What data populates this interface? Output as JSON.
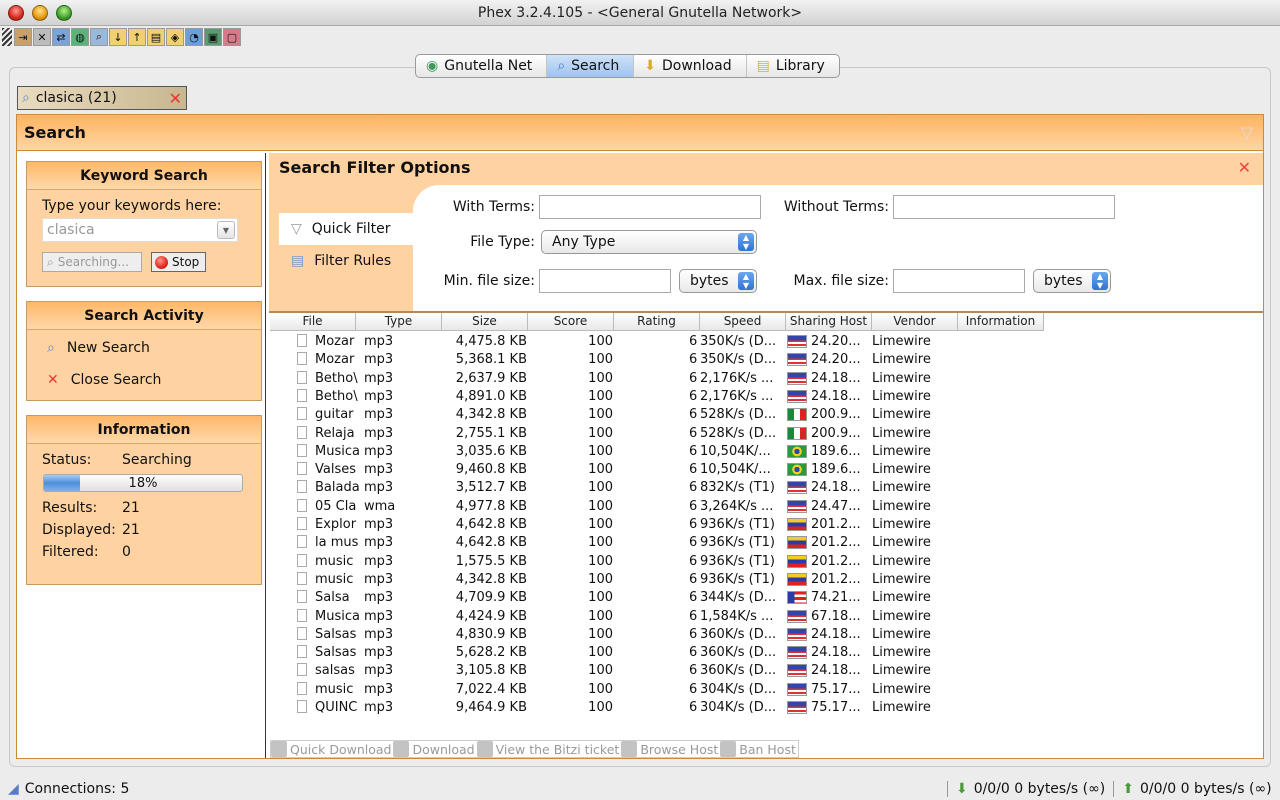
{
  "window": {
    "title": "Phex 3.2.4.105 - <General Gnutella Network>"
  },
  "toolbar": {
    "icons": [
      "exit-icon",
      "disconnect-icon",
      "connect-icon",
      "network-icon",
      "search-icon",
      "download-folder-icon",
      "upload-folder-icon",
      "library-folder-icon",
      "shield-icon",
      "statistics-icon",
      "monitor-icon",
      "chat-icon"
    ]
  },
  "tabs": [
    {
      "label": "Gnutella Net",
      "icon": "globe-icon",
      "active": false
    },
    {
      "label": "Search",
      "icon": "search-icon",
      "active": true
    },
    {
      "label": "Download",
      "icon": "download-icon",
      "active": false
    },
    {
      "label": "Library",
      "icon": "library-icon",
      "active": false
    }
  ],
  "search_tab": {
    "label": "clasica (21)"
  },
  "panel": {
    "title": "Search"
  },
  "keyword_search": {
    "title": "Keyword Search",
    "prompt": "Type your keywords here:",
    "value": "clasica",
    "searching_label": "Searching...",
    "stop_label": "Stop"
  },
  "search_activity": {
    "title": "Search Activity",
    "new_search": "New Search",
    "close_search": "Close Search"
  },
  "information": {
    "title": "Information",
    "status_label": "Status:",
    "status_value": "Searching",
    "progress_percent": 18,
    "progress_text": "18%",
    "results_label": "Results:",
    "results_value": "21",
    "displayed_label": "Displayed:",
    "displayed_value": "21",
    "filtered_label": "Filtered:",
    "filtered_value": "0"
  },
  "filter": {
    "title": "Search Filter Options",
    "quick_filter": "Quick Filter",
    "filter_rules": "Filter Rules",
    "with_terms_label": "With Terms:",
    "with_terms_value": "",
    "without_terms_label": "Without Terms:",
    "without_terms_value": "",
    "file_type_label": "File Type:",
    "file_type_value": "Any Type",
    "min_size_label": "Min. file size:",
    "min_size_value": "",
    "min_unit": "bytes",
    "max_size_label": "Max. file size:",
    "max_size_value": "",
    "max_unit": "bytes"
  },
  "table": {
    "columns": [
      "File",
      "Type",
      "Size",
      "Score",
      "Rating",
      "Speed",
      "Sharing Host",
      "Vendor",
      "Information"
    ],
    "rows": [
      {
        "file": "Mozar",
        "type": "mp3",
        "size": "4,475.8 KB",
        "score": "100",
        "rating": "6",
        "speed": "350K/s (D...",
        "flag": "us",
        "host": "24.20...",
        "vendor": "Limewire"
      },
      {
        "file": "Mozar",
        "type": "mp3",
        "size": "5,368.1 KB",
        "score": "100",
        "rating": "6",
        "speed": "350K/s (D...",
        "flag": "us",
        "host": "24.20...",
        "vendor": "Limewire"
      },
      {
        "file": "Betho\\",
        "type": "mp3",
        "size": "2,637.9 KB",
        "score": "100",
        "rating": "6",
        "speed": "2,176K/s ...",
        "flag": "us",
        "host": "24.18...",
        "vendor": "Limewire"
      },
      {
        "file": "Betho\\",
        "type": "mp3",
        "size": "4,891.0 KB",
        "score": "100",
        "rating": "6",
        "speed": "2,176K/s ...",
        "flag": "us",
        "host": "24.18...",
        "vendor": "Limewire"
      },
      {
        "file": "guitar",
        "type": "mp3",
        "size": "4,342.8 KB",
        "score": "100",
        "rating": "6",
        "speed": "528K/s (D...",
        "flag": "mx",
        "host": "200.9...",
        "vendor": "Limewire"
      },
      {
        "file": "Relaja",
        "type": "mp3",
        "size": "2,755.1 KB",
        "score": "100",
        "rating": "6",
        "speed": "528K/s (D...",
        "flag": "mx",
        "host": "200.9...",
        "vendor": "Limewire"
      },
      {
        "file": "Musica",
        "type": "mp3",
        "size": "3,035.6 KB",
        "score": "100",
        "rating": "6",
        "speed": "10,504K/...",
        "flag": "br",
        "host": "189.6...",
        "vendor": "Limewire"
      },
      {
        "file": "Valses",
        "type": "mp3",
        "size": "9,460.8 KB",
        "score": "100",
        "rating": "6",
        "speed": "10,504K/...",
        "flag": "br",
        "host": "189.6...",
        "vendor": "Limewire"
      },
      {
        "file": "Balada",
        "type": "mp3",
        "size": "3,512.7 KB",
        "score": "100",
        "rating": "6",
        "speed": "832K/s (T1)",
        "flag": "us",
        "host": "24.18...",
        "vendor": "Limewire"
      },
      {
        "file": "05 Cla",
        "type": "wma",
        "size": "4,977.8 KB",
        "score": "100",
        "rating": "6",
        "speed": "3,264K/s ...",
        "flag": "us",
        "host": "24.47...",
        "vendor": "Limewire"
      },
      {
        "file": "Explor",
        "type": "mp3",
        "size": "4,642.8 KB",
        "score": "100",
        "rating": "6",
        "speed": "936K/s (T1)",
        "flag": "ve",
        "host": "201.2...",
        "vendor": "Limewire"
      },
      {
        "file": "la mus",
        "type": "mp3",
        "size": "4,642.8 KB",
        "score": "100",
        "rating": "6",
        "speed": "936K/s (T1)",
        "flag": "ve",
        "host": "201.2...",
        "vendor": "Limewire"
      },
      {
        "file": "music",
        "type": "mp3",
        "size": "1,575.5 KB",
        "score": "100",
        "rating": "6",
        "speed": "936K/s (T1)",
        "flag": "ve",
        "host": "201.2...",
        "vendor": "Limewire"
      },
      {
        "file": "music",
        "type": "mp3",
        "size": "4,342.8 KB",
        "score": "100",
        "rating": "6",
        "speed": "936K/s (T1)",
        "flag": "ve",
        "host": "201.2...",
        "vendor": "Limewire"
      },
      {
        "file": "Salsa ",
        "type": "mp3",
        "size": "4,709.9 KB",
        "score": "100",
        "rating": "6",
        "speed": "344K/s (D...",
        "flag": "pr",
        "host": "74.21...",
        "vendor": "Limewire"
      },
      {
        "file": "Musica",
        "type": "mp3",
        "size": "4,424.9 KB",
        "score": "100",
        "rating": "6",
        "speed": "1,584K/s ...",
        "flag": "us",
        "host": "67.18...",
        "vendor": "Limewire"
      },
      {
        "file": "Salsas",
        "type": "mp3",
        "size": "4,830.9 KB",
        "score": "100",
        "rating": "6",
        "speed": "360K/s (D...",
        "flag": "us",
        "host": "24.18...",
        "vendor": "Limewire"
      },
      {
        "file": "Salsas",
        "type": "mp3",
        "size": "5,628.2 KB",
        "score": "100",
        "rating": "6",
        "speed": "360K/s (D...",
        "flag": "us",
        "host": "24.18...",
        "vendor": "Limewire"
      },
      {
        "file": "salsas",
        "type": "mp3",
        "size": "3,105.8 KB",
        "score": "100",
        "rating": "6",
        "speed": "360K/s (D...",
        "flag": "us",
        "host": "24.18...",
        "vendor": "Limewire"
      },
      {
        "file": "music",
        "type": "mp3",
        "size": "7,022.4 KB",
        "score": "100",
        "rating": "6",
        "speed": "304K/s (D...",
        "flag": "us",
        "host": "75.17...",
        "vendor": "Limewire"
      },
      {
        "file": "QUINC",
        "type": "mp3",
        "size": "9,464.9 KB",
        "score": "100",
        "rating": "6",
        "speed": "304K/s (D...",
        "flag": "us",
        "host": "75.17...",
        "vendor": "Limewire"
      }
    ]
  },
  "actions": [
    "Quick Download",
    "Download",
    "View the Bitzi ticket",
    "Browse Host",
    "Ban Host"
  ],
  "statusbar": {
    "connections": "Connections: 5",
    "download": "0/0/0 0 bytes/s (∞)",
    "upload": "0/0/0 0 bytes/s (∞)"
  },
  "colors": {
    "accent": "#ffb35e",
    "panel": "#ffd3a1",
    "selected_tab": "#9ec3ee"
  }
}
